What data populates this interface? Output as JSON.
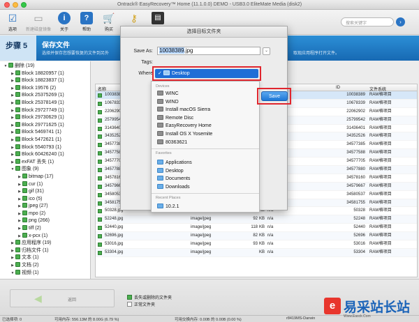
{
  "window": {
    "title": "Ontrack® EasyRecovery™ Home (11.1.0.0) DEMO - USB3.0 EliteMate Media (disk2)"
  },
  "toolbar": {
    "buttons": [
      {
        "label": "选项",
        "icon": "checklist-icon"
      },
      {
        "label": "新建磁盘镜像",
        "icon": "disk-image-icon"
      },
      {
        "label": "关于",
        "icon": "info-icon"
      },
      {
        "label": "帮助",
        "icon": "help-icon"
      },
      {
        "label": "购买",
        "icon": "cart-icon"
      },
      {
        "label": "",
        "icon": "key-icon"
      },
      {
        "label": "",
        "icon": "save-disk-icon"
      }
    ],
    "search_placeholder": "搜索关键字"
  },
  "step": {
    "number": "步骤 5",
    "title": "保存文件",
    "description": "选择并保存您想要恢复的文件到另外",
    "description_right": "取现应用程序打开文件。"
  },
  "tree": [
    {
      "label": "删除 (19)",
      "level": 0,
      "arrow": "▼"
    },
    {
      "label": "Block 18820957 (1)",
      "level": 1,
      "arrow": "▶"
    },
    {
      "label": "Block 18823837 (1)",
      "level": 1,
      "arrow": "▶"
    },
    {
      "label": "Block 19576 (2)",
      "level": 1,
      "arrow": "▶"
    },
    {
      "label": "Block 25375269 (1)",
      "level": 1,
      "arrow": "▶"
    },
    {
      "label": "Block 25378149 (1)",
      "level": 1,
      "arrow": "▶"
    },
    {
      "label": "Block 29727749 (1)",
      "level": 1,
      "arrow": "▶"
    },
    {
      "label": "Block 29730629 (1)",
      "level": 1,
      "arrow": "▶"
    },
    {
      "label": "Block 29771625 (1)",
      "level": 1,
      "arrow": "▶"
    },
    {
      "label": "Block 5469741 (1)",
      "level": 1,
      "arrow": "▶"
    },
    {
      "label": "Block 5472621 (1)",
      "level": 1,
      "arrow": "▶"
    },
    {
      "label": "Block 5540793 (1)",
      "level": 1,
      "arrow": "▶"
    },
    {
      "label": "Block 60426240 (1)",
      "level": 1,
      "arrow": "▶"
    },
    {
      "label": "exFAT 丢失 (1)",
      "level": 1,
      "arrow": "▶"
    },
    {
      "label": "图象 (9)",
      "level": 1,
      "arrow": "▼"
    },
    {
      "label": "bitmap (17)",
      "level": 2,
      "arrow": "▶"
    },
    {
      "label": "cur (1)",
      "level": 2,
      "arrow": "▶"
    },
    {
      "label": "gif (31)",
      "level": 2,
      "arrow": "▶"
    },
    {
      "label": "ico (5)",
      "level": 2,
      "arrow": "▶"
    },
    {
      "label": "jpeg (27)",
      "level": 2,
      "arrow": "▶"
    },
    {
      "label": "mpo (2)",
      "level": 2,
      "arrow": "▶"
    },
    {
      "label": "png (266)",
      "level": 2,
      "arrow": "▶"
    },
    {
      "label": "tiff (2)",
      "level": 2,
      "arrow": "▶"
    },
    {
      "label": "x-pcx (1)",
      "level": 2,
      "arrow": "▶"
    },
    {
      "label": "应用程序 (19)",
      "level": 1,
      "arrow": "▶"
    },
    {
      "label": "归档文件 (1)",
      "level": 1,
      "arrow": "▶"
    },
    {
      "label": "文本 (1)",
      "level": 1,
      "arrow": "▶"
    },
    {
      "label": "文档 (2)",
      "level": 1,
      "arrow": "▶"
    },
    {
      "label": "视频 (1)",
      "level": 1,
      "arrow": "▼"
    }
  ],
  "table": {
    "headers": {
      "name": "名称",
      "id": "ID",
      "file": "文件系统"
    },
    "rows": [
      {
        "name": "10038389.jpg",
        "type": "",
        "size": "",
        "kb": "",
        "na": "",
        "id": "10038389",
        "file": "RAW格项目",
        "selected": true
      },
      {
        "name": "10678339.jpg",
        "type": "",
        "size": "",
        "kb": "KB",
        "na": "n/a",
        "id": "10678339",
        "file": "RAW格项目"
      },
      {
        "name": "22062902.jpg",
        "type": "",
        "size": "",
        "kb": "KB",
        "na": "n/a",
        "id": "22062902",
        "file": "RAW格项目"
      },
      {
        "name": "25799542.jpg",
        "type": "",
        "size": "",
        "kb": "KB",
        "na": "n/a",
        "id": "25799542",
        "file": "RAW格项目"
      },
      {
        "name": "31436401.jpg",
        "type": "",
        "size": "",
        "kb": "KB",
        "na": "n/a",
        "id": "31436401",
        "file": "RAW格项目"
      },
      {
        "name": "34352526.jpg",
        "type": "",
        "size": "",
        "kb": "KB",
        "na": "n/a",
        "id": "34352526",
        "file": "RAW格项目"
      },
      {
        "name": "34577385.jpg",
        "type": "",
        "size": "",
        "kb": "KB",
        "na": "n/a",
        "id": "34577385",
        "file": "RAW格项目"
      },
      {
        "name": "34577588.jpg",
        "type": "",
        "size": "",
        "kb": "KB",
        "na": "n/a",
        "id": "34577588",
        "file": "RAW格项目"
      },
      {
        "name": "34577705.jpg",
        "type": "",
        "size": "",
        "kb": "KB",
        "na": "n/a",
        "id": "34577705",
        "file": "RAW格项目"
      },
      {
        "name": "34577880.jpg",
        "type": "",
        "size": "",
        "kb": "KB",
        "na": "n/a",
        "id": "34577880",
        "file": "RAW格项目"
      },
      {
        "name": "34578160.jpg",
        "type": "",
        "size": "",
        "kb": "KB",
        "na": "n/a",
        "id": "34578160",
        "file": "RAW格项目"
      },
      {
        "name": "34579667.jpg",
        "type": "",
        "size": "",
        "kb": "KB",
        "na": "n/a",
        "id": "34579667",
        "file": "RAW格项目"
      },
      {
        "name": "34580537.jpg",
        "type": "",
        "size": "",
        "kb": "KB",
        "na": "n/a",
        "id": "34580537",
        "file": "RAW格项目"
      },
      {
        "name": "34581755.jpg",
        "type": "image/jpeg",
        "size": "822855",
        "kb": "KB",
        "na": "n/a",
        "id": "34581755",
        "file": "RAW格项目"
      },
      {
        "name": "50328.jpg",
        "type": "image/jpeg",
        "size": "79",
        "kb": "KB",
        "na": "n/a",
        "id": "50328",
        "file": "RAW格项目"
      },
      {
        "name": "52248.jpg",
        "type": "image/jpeg",
        "size": "92",
        "kb": "KB",
        "na": "n/a",
        "id": "52248",
        "file": "RAW格项目"
      },
      {
        "name": "52440.jpg",
        "type": "image/jpeg",
        "size": "118",
        "kb": "KB",
        "na": "n/a",
        "id": "52440",
        "file": "RAW格项目"
      },
      {
        "name": "52696.jpg",
        "type": "image/jpeg",
        "size": "82",
        "kb": "KB",
        "na": "n/a",
        "id": "52696",
        "file": "RAW格项目"
      },
      {
        "name": "53016.jpg",
        "type": "image/jpeg",
        "size": "93",
        "kb": "KB",
        "na": "n/a",
        "id": "53016",
        "file": "RAW格项目"
      },
      {
        "name": "53304.jpg",
        "type": "image/jpeg",
        "size": "",
        "kb": "KB",
        "na": "n/a",
        "id": "53304",
        "file": "RAW格项目"
      }
    ]
  },
  "dialog": {
    "title": "选择目标文件夹",
    "save_as_label": "Save As:",
    "save_as_name": "10038389",
    "save_as_ext": ".jpg",
    "tags_label": "Tags:",
    "where_label": "Where",
    "where_value": "Desktop",
    "save_button": "Save",
    "devices_header": "Devices",
    "devices": [
      "WINC",
      "WIND",
      "Install macOS Sierra",
      "Remote Disc",
      "EasyRecovery Home",
      "Install OS X Yosemite",
      "80363621"
    ],
    "favorites_header": "Favorites",
    "favorites": [
      "Applications",
      "Desktop",
      "Documents",
      "Downloads"
    ],
    "recent_header": "Recent Places",
    "recent": [
      "10.2.1"
    ],
    "highlight_color": "#e0262e"
  },
  "bottom": {
    "back_label": "返回",
    "legend": [
      "丢失或删除的文件夹",
      "正常文件夹"
    ]
  },
  "status": {
    "selected": "已选择项: 0",
    "memory": "可用内存: 556.13M 的 8.00G (6.79 %)",
    "disk": "可用交换内存: 0.00B 的 0.00B (0.00 %)",
    "build": "r8419MS-Darwin"
  },
  "watermark": {
    "logo": "e",
    "text": "易采站长站",
    "url": "Www.Easck.Com"
  }
}
